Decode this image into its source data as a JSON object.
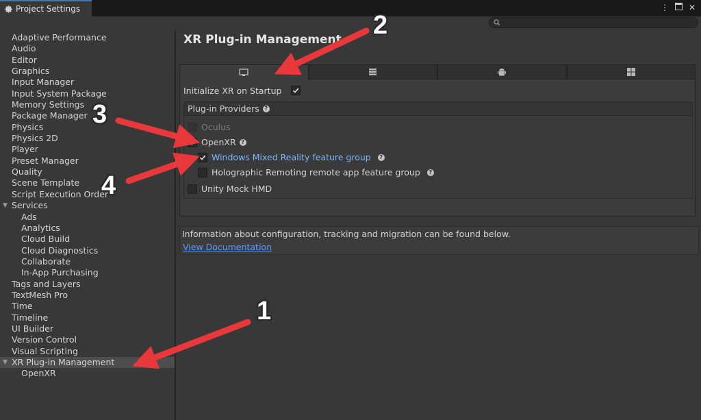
{
  "window": {
    "tab_title": "Project Settings",
    "tab_icon": "gear-icon",
    "controls": [
      "kebab-menu-icon",
      "maximize-icon",
      "close-icon"
    ]
  },
  "search": {
    "placeholder": ""
  },
  "sidebar": {
    "items": [
      {
        "label": "Adaptive Performance",
        "level": 0
      },
      {
        "label": "Audio",
        "level": 0
      },
      {
        "label": "Editor",
        "level": 0
      },
      {
        "label": "Graphics",
        "level": 0
      },
      {
        "label": "Input Manager",
        "level": 0
      },
      {
        "label": "Input System Package",
        "level": 0
      },
      {
        "label": "Memory Settings",
        "level": 0
      },
      {
        "label": "Package Manager",
        "level": 0
      },
      {
        "label": "Physics",
        "level": 0
      },
      {
        "label": "Physics 2D",
        "level": 0
      },
      {
        "label": "Player",
        "level": 0
      },
      {
        "label": "Preset Manager",
        "level": 0
      },
      {
        "label": "Quality",
        "level": 0
      },
      {
        "label": "Scene Template",
        "level": 0
      },
      {
        "label": "Script Execution Order",
        "level": 0
      },
      {
        "label": "Services",
        "level": 0,
        "foldout": true
      },
      {
        "label": "Ads",
        "level": 1
      },
      {
        "label": "Analytics",
        "level": 1
      },
      {
        "label": "Cloud Build",
        "level": 1
      },
      {
        "label": "Cloud Diagnostics",
        "level": 1
      },
      {
        "label": "Collaborate",
        "level": 1
      },
      {
        "label": "In-App Purchasing",
        "level": 1
      },
      {
        "label": "Tags and Layers",
        "level": 0
      },
      {
        "label": "TextMesh Pro",
        "level": 0
      },
      {
        "label": "Time",
        "level": 0
      },
      {
        "label": "Timeline",
        "level": 0
      },
      {
        "label": "UI Builder",
        "level": 0
      },
      {
        "label": "Version Control",
        "level": 0
      },
      {
        "label": "Visual Scripting",
        "level": 0
      },
      {
        "label": "XR Plug-in Management",
        "level": 0,
        "foldout": true,
        "selected": true
      },
      {
        "label": "OpenXR",
        "level": 1
      }
    ]
  },
  "main": {
    "title": "XR Plug-in Management",
    "platform_tabs": [
      {
        "icon": "desktop-monitor-icon",
        "active": true
      },
      {
        "icon": "server-icon",
        "active": false
      },
      {
        "icon": "android-icon",
        "active": false
      },
      {
        "icon": "windows-icon",
        "active": false
      }
    ],
    "init_label": "Initialize XR on Startup",
    "init_checked": true,
    "providers_header": "Plug-in Providers",
    "providers": [
      {
        "label": "Oculus",
        "checked": false,
        "disabled": true
      },
      {
        "label": "OpenXR",
        "checked": true,
        "help": true
      },
      {
        "label": "Windows Mixed Reality feature group",
        "checked": true,
        "help": true,
        "highlight": true
      },
      {
        "label": "Holographic Remoting remote app feature group",
        "checked": false,
        "help": true
      },
      {
        "label": "Unity Mock HMD",
        "checked": false
      }
    ],
    "info_text": "Information about configuration, tracking and migration can be found below.",
    "doc_link": "View Documentation"
  },
  "annotations": {
    "numbers": [
      "1",
      "2",
      "3",
      "4"
    ],
    "arrow_color": "#e8383b"
  }
}
